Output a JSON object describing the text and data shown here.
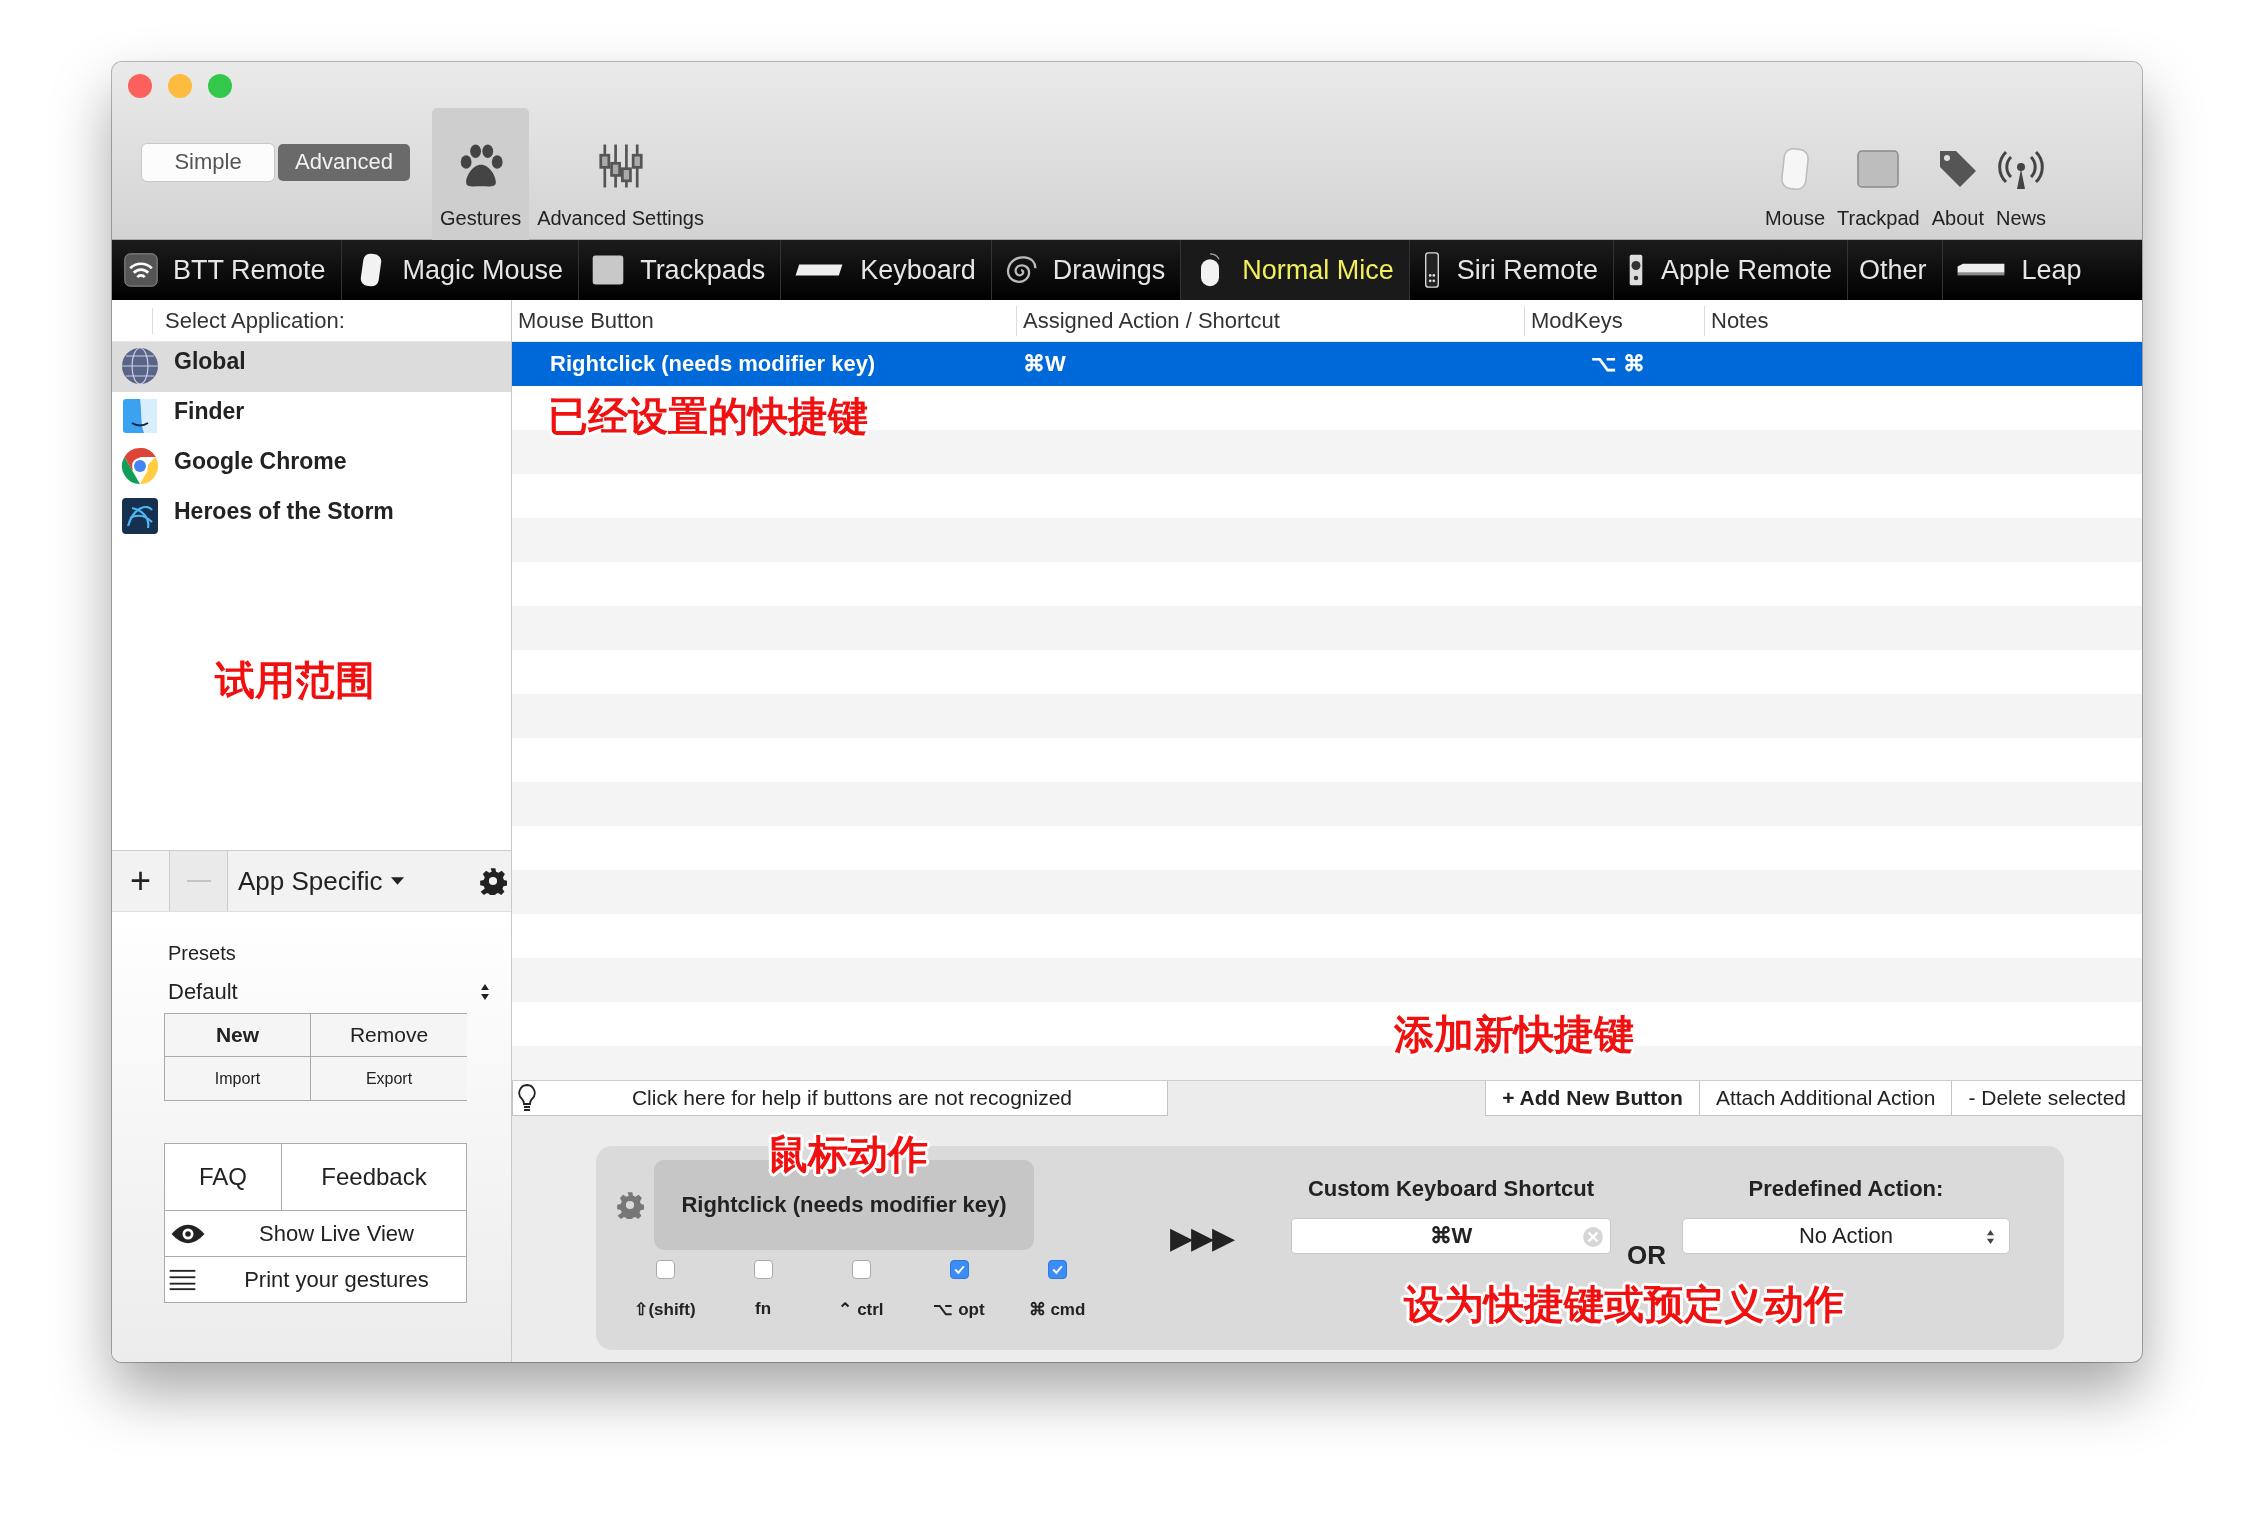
{
  "window": {
    "controls": [
      {
        "color": "#fc605c"
      },
      {
        "color": "#fdbc40"
      },
      {
        "color": "#34c84a"
      }
    ]
  },
  "mode_switch": [
    {
      "label": "Simple",
      "selected": false
    },
    {
      "label": "Advanced",
      "selected": true
    }
  ],
  "toolbar_left": [
    {
      "label": "Gestures",
      "kind": "paw",
      "selected": true
    },
    {
      "label": "Advanced Settings",
      "kind": "sliders",
      "selected": false
    }
  ],
  "toolbar_right": [
    {
      "label": "Mouse",
      "kind": "mouse"
    },
    {
      "label": "Trackpad",
      "kind": "trackpad"
    },
    {
      "label": "About",
      "kind": "tag"
    },
    {
      "label": "News",
      "kind": "antenna"
    }
  ],
  "device_tabs": [
    {
      "label": "BTT Remote",
      "kind": "remote",
      "selected": false
    },
    {
      "label": "Magic Mouse",
      "kind": "magicmouse",
      "selected": false
    },
    {
      "label": "Trackpads",
      "kind": "trackpad",
      "selected": false
    },
    {
      "label": "Keyboard",
      "kind": "keyboard",
      "selected": false
    },
    {
      "label": "Drawings",
      "kind": "spiral",
      "selected": false
    },
    {
      "label": "Normal Mice",
      "kind": "mouse",
      "selected": true
    },
    {
      "label": "Siri Remote",
      "kind": "siri",
      "selected": false
    },
    {
      "label": "Apple Remote",
      "kind": "appleremote",
      "selected": false
    },
    {
      "label": "Other",
      "kind": "none",
      "selected": false
    },
    {
      "label": "Leap",
      "kind": "leap",
      "selected": false
    }
  ],
  "sidebar": {
    "header": "Select Application:",
    "apps": [
      {
        "name": "Global",
        "kind": "globe",
        "selected": true
      },
      {
        "name": "Finder",
        "kind": "finder",
        "selected": false
      },
      {
        "name": "Google Chrome",
        "kind": "chrome",
        "selected": false
      },
      {
        "name": "Heroes of the Storm",
        "kind": "heroes",
        "selected": false
      }
    ],
    "tools": [
      {
        "label": "+",
        "disabled": false
      },
      {
        "disabled": true
      }
    ],
    "scope": "App Specific",
    "presets": {
      "label": "Presets",
      "value": "Default",
      "buttons": [
        {
          "label": "New",
          "default": true
        },
        {
          "label": "Remove",
          "default": false
        },
        {
          "label": "Import",
          "default": false
        },
        {
          "label": "Export",
          "default": false
        }
      ]
    },
    "links": [
      "FAQ",
      "Feedback"
    ],
    "live_view": "Show Live View",
    "print": "Print your gestures"
  },
  "table": {
    "columns": [
      "Mouse Button",
      "Assigned Action / Shortcut",
      "ModKeys",
      "Notes"
    ],
    "rows": [
      {
        "button": "Rightclick (needs modifier key)",
        "action": "⌘W",
        "modkeys": "⌥ ⌘",
        "selected": true
      }
    ]
  },
  "help_bar": "Click here for help if buttons are not recognized",
  "action_buttons": [
    {
      "label": "+ Add New Button",
      "primary": true
    },
    {
      "label": "Attach Additional Action",
      "primary": false
    },
    {
      "label": "- Delete selected",
      "primary": false
    }
  ],
  "editor": {
    "trigger": "Rightclick (needs modifier key)",
    "modifiers": [
      {
        "label": "⇧(shift)",
        "checked": false
      },
      {
        "label": "fn",
        "checked": false
      },
      {
        "label": "⌃ ctrl",
        "checked": false
      },
      {
        "label": "⌥ opt",
        "checked": true
      },
      {
        "label": "⌘ cmd",
        "checked": true
      }
    ],
    "arrows": "▶▶▶",
    "shortcut_title": "Custom Keyboard Shortcut",
    "shortcut_value": "⌘W",
    "or": "OR",
    "predefined_title": "Predefined Action:",
    "predefined_value": "No Action"
  },
  "annotations": [
    "已经设置的快捷键",
    "试用范围",
    "添加新快捷键",
    "鼠标动作",
    "设为快捷键或预定义动作"
  ]
}
